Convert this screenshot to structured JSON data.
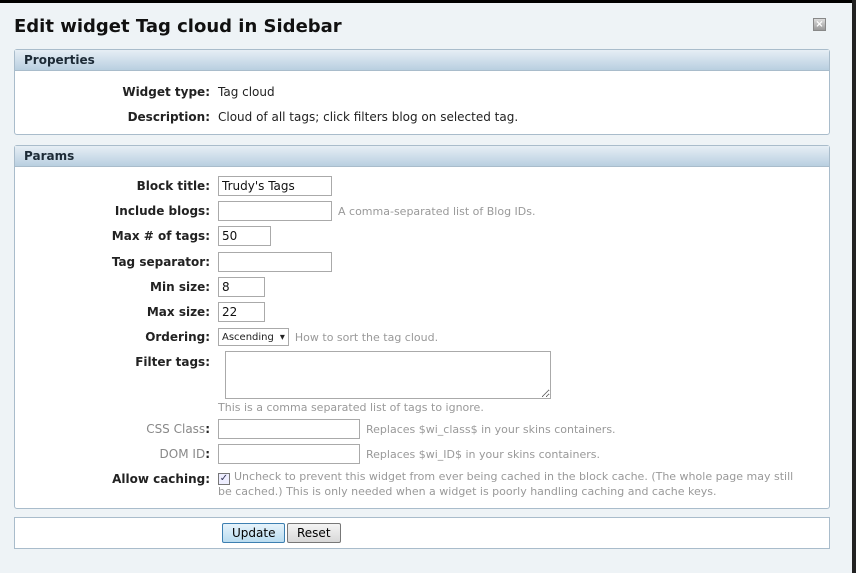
{
  "dialog": {
    "title": "Edit widget Tag cloud in Sidebar",
    "close_icon": "close-icon"
  },
  "properties": {
    "header": "Properties",
    "widget_type_label": "Widget type:",
    "widget_type": "Tag cloud",
    "description_label": "Description:",
    "description": "Cloud of all tags; click filters blog on selected tag."
  },
  "params": {
    "header": "Params",
    "block_title": {
      "label": "Block title:",
      "value": "Trudy's Tags"
    },
    "include_blogs": {
      "label": "Include blogs:",
      "value": "",
      "note": "A comma-separated list of Blog IDs."
    },
    "max_tags": {
      "label": "Max # of tags:",
      "value": "50"
    },
    "tag_separator": {
      "label": "Tag separator:",
      "value": ""
    },
    "min_size": {
      "label": "Min size:",
      "value": "8"
    },
    "max_size": {
      "label": "Max size:",
      "value": "22"
    },
    "ordering": {
      "label": "Ordering:",
      "value": "Ascending",
      "note": "How to sort the tag cloud."
    },
    "filter_tags": {
      "label": "Filter tags:",
      "value": "",
      "note": "This is a comma separated list of tags to ignore."
    },
    "css_class": {
      "label": "CSS Class",
      "value": "",
      "note": "Replaces $wi_class$ in your skins containers."
    },
    "dom_id": {
      "label": "DOM ID",
      "value": "",
      "note": "Replaces $wi_ID$ in your skins containers."
    },
    "allow_caching": {
      "label": "Allow caching:",
      "checked": true,
      "note": "Uncheck to prevent this widget from ever being cached in the block cache. (The whole page may still be cached.) This is only needed when a widget is poorly handling caching and cache keys."
    }
  },
  "footer": {
    "update": "Update",
    "reset": "Reset"
  }
}
